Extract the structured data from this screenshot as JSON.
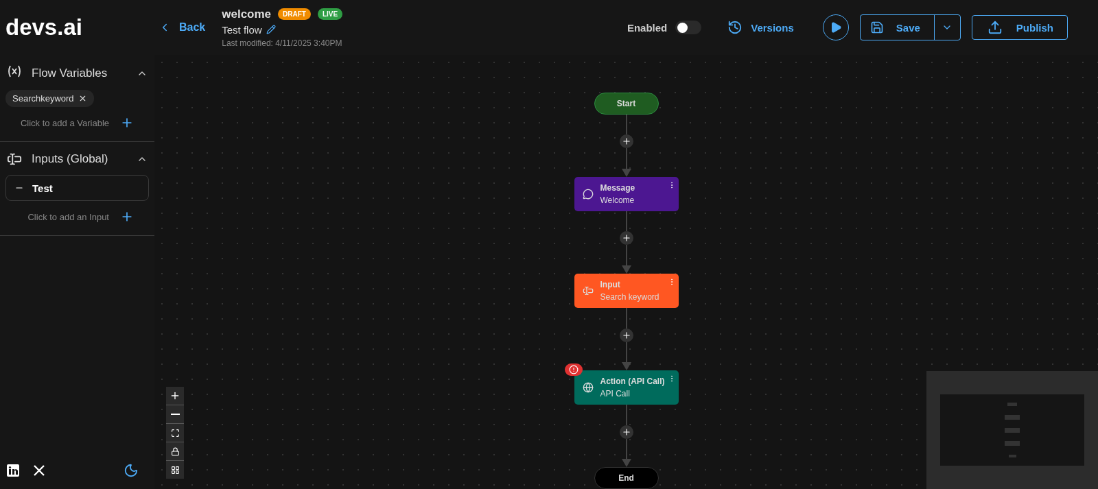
{
  "brand": "devs.ai",
  "header": {
    "back": "Back",
    "flow_name": "welcome",
    "badges": [
      {
        "label": "DRAFT",
        "color": "#f08c00"
      },
      {
        "label": "LIVE",
        "color": "#2f9e44"
      }
    ],
    "title": "Test flow",
    "modified": "Last modified: 4/11/2025 3:40PM",
    "enabled_label": "Enabled",
    "enabled": false,
    "versions": "Versions",
    "save": "Save",
    "publish": "Publish"
  },
  "sidebar": {
    "sections": [
      {
        "title": "Flow Variables",
        "kind": "variables",
        "expanded": true,
        "items": [
          "Searchkeyword"
        ],
        "add": "Click to add a Variable"
      },
      {
        "title": "Inputs (Global)",
        "kind": "inputs",
        "expanded": true,
        "items": [
          "Test"
        ],
        "add": "Click to add an Input"
      }
    ]
  },
  "flow": {
    "nodes": [
      {
        "kind": "terminal",
        "title": "Start",
        "color": "#1f5c21"
      },
      {
        "kind": "message",
        "title": "Message",
        "subtitle": "Welcome",
        "color": "#4c1791",
        "error": false
      },
      {
        "kind": "input",
        "title": "Input",
        "subtitle": "Search keyword",
        "color": "#ff5722",
        "error": false
      },
      {
        "kind": "action",
        "title": "Action (API Call)",
        "subtitle": "API Call",
        "color": "#006b5c",
        "error": true
      },
      {
        "kind": "terminal",
        "title": "End",
        "color": "#000000"
      }
    ]
  }
}
